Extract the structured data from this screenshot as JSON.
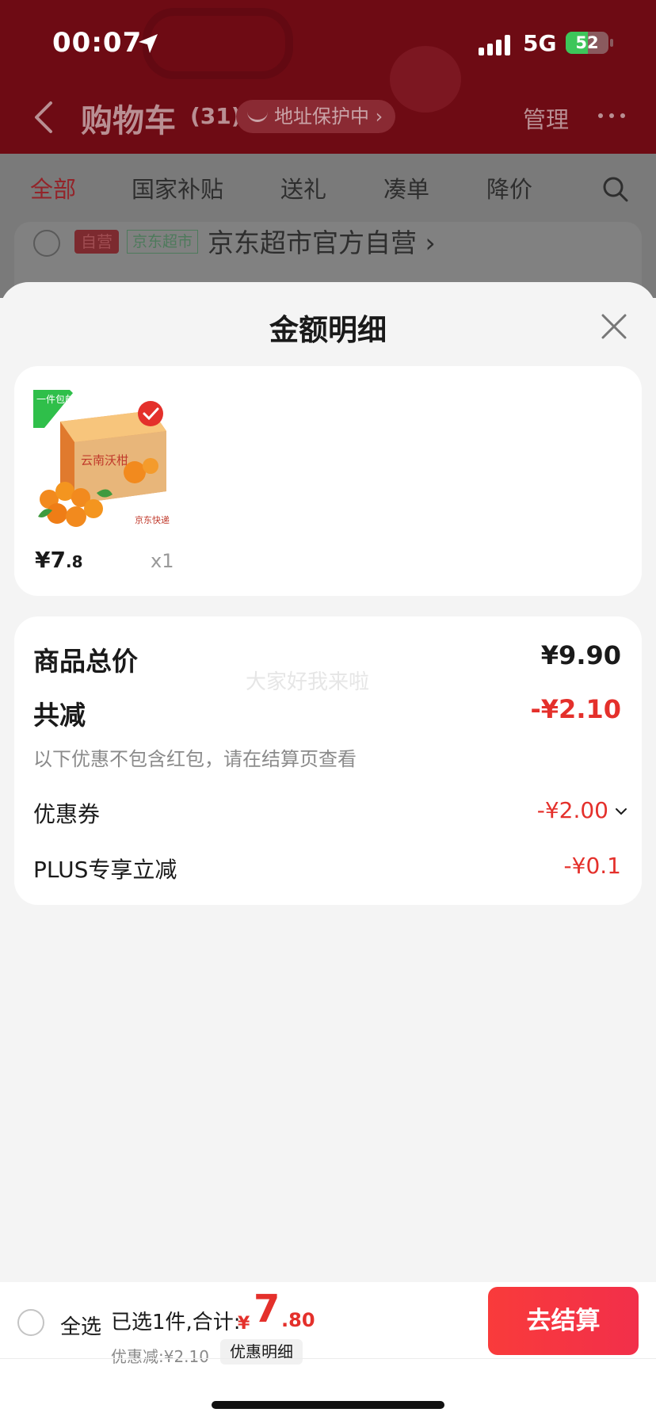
{
  "status_bar": {
    "time": "00:07",
    "network": "5G",
    "battery_percent": 52,
    "battery_text": "52"
  },
  "header": {
    "title": "购物车",
    "count": "(31)",
    "address_protect": "地址保护中 ›",
    "manage": "管理"
  },
  "tabs": [
    "全部",
    "国家补贴",
    "送礼",
    "凑单",
    "降价"
  ],
  "store": {
    "badge_self": "自营",
    "badge_jd": "京东超市",
    "name": "京东超市官方自营 ›"
  },
  "sheet": {
    "title": "金额明细",
    "product": {
      "thumb_badge": "一件包邮",
      "thumb_box_text": "云南沃柑",
      "thumb_ship_text": "京东快递",
      "price_int": "¥7",
      "price_dec": ".8",
      "qty": "x1"
    },
    "summary": {
      "total_label": "商品总价",
      "total_value": "¥9.90",
      "reduce_label": "共减",
      "reduce_value": "-¥2.10",
      "note": "以下优惠不包含红包，请在结算页查看",
      "coupon_label": "优惠券",
      "coupon_value": "-¥2.00",
      "plus_label": "PLUS专享立减",
      "plus_value": "-¥0.1",
      "watermark": "大家好我来啦"
    }
  },
  "bottom_bar": {
    "select_all": "全选",
    "selected": "已选1件,合计:",
    "currency": "¥",
    "total_int": "7",
    "total_dec": ".80",
    "discount": "优惠减:¥2.10",
    "detail_chip": "优惠明细",
    "checkout": "去结算"
  },
  "colors": {
    "accent_red": "#e4302b",
    "header_bg": "#6e0b14",
    "battery_green": "#3dc65a"
  }
}
